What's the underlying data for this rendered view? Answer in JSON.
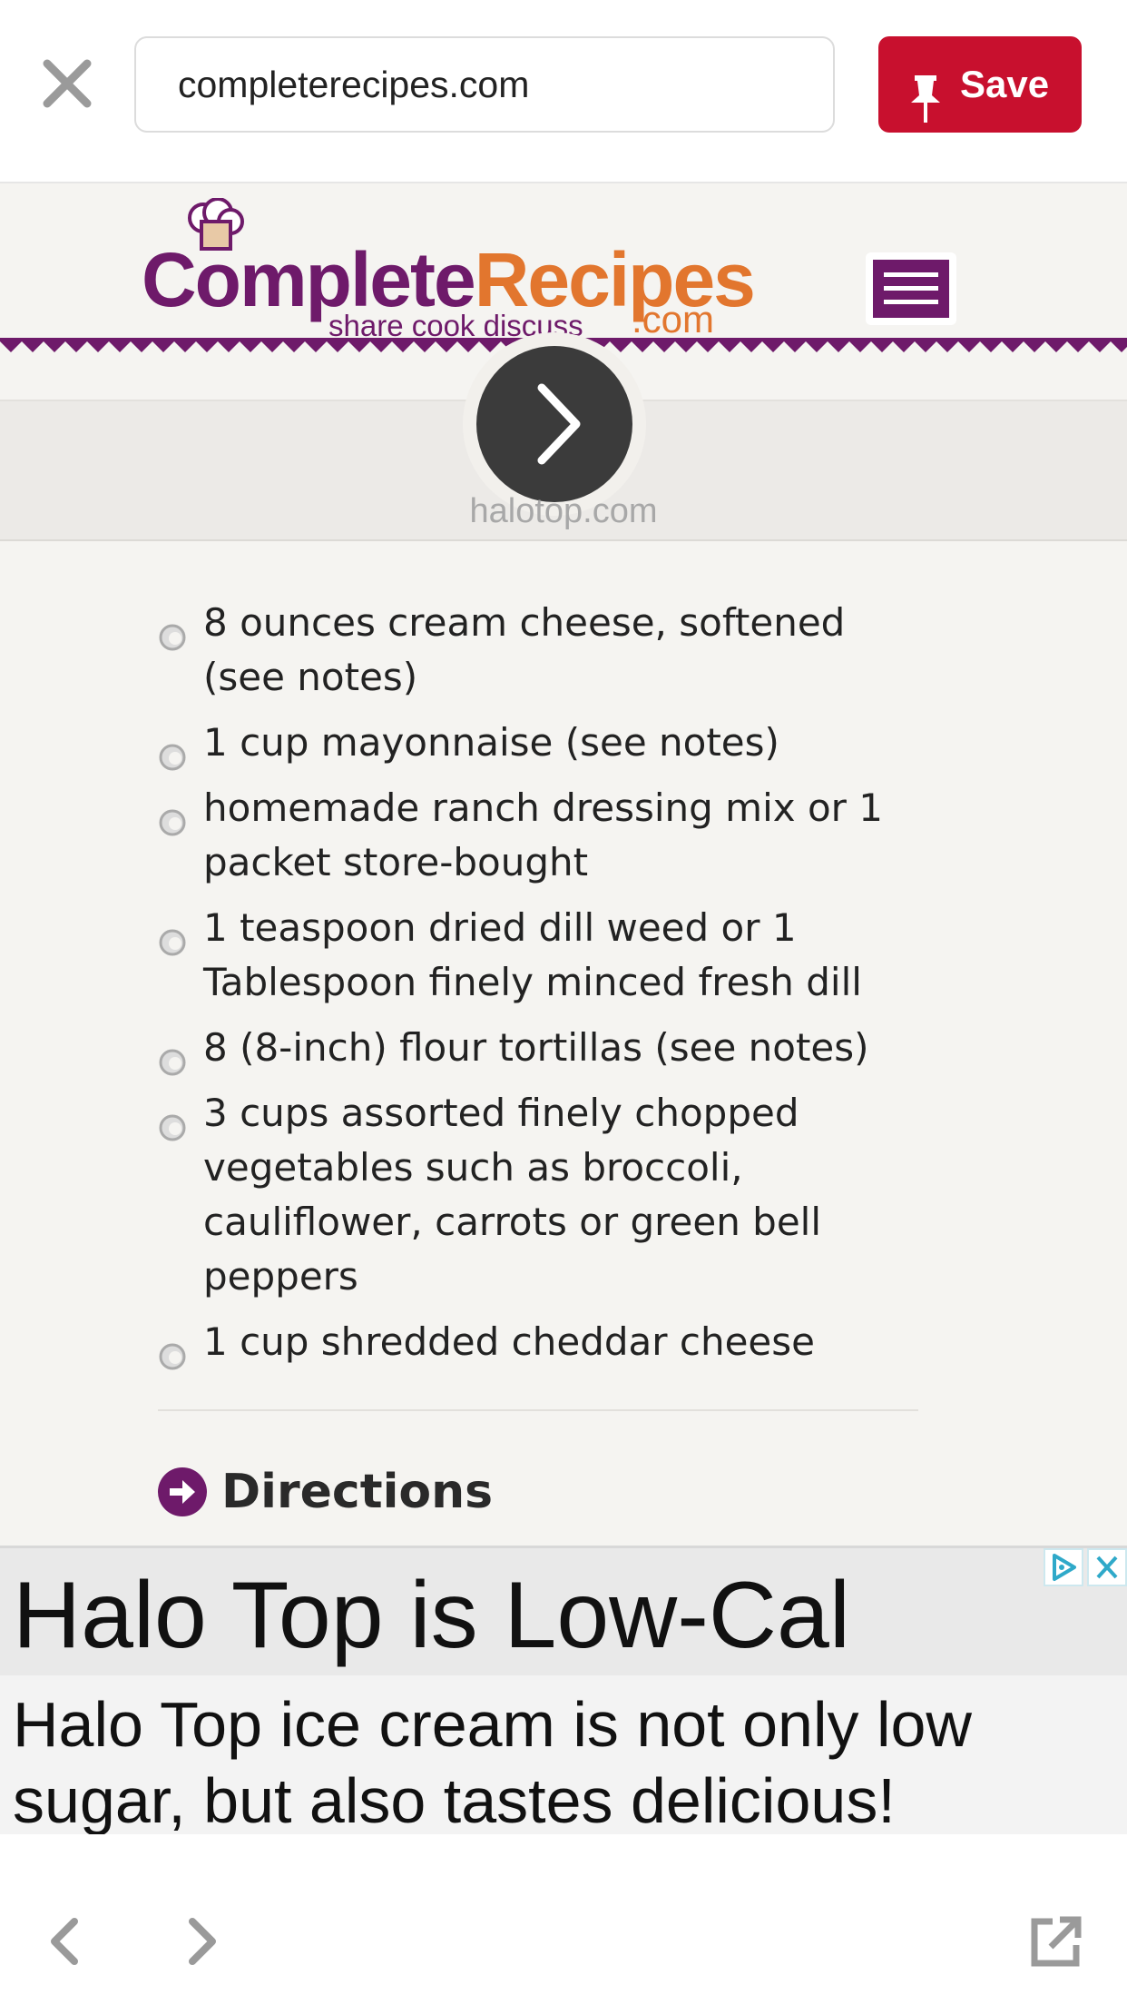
{
  "browser": {
    "close_icon": "close-icon",
    "url": "completerecipes.com",
    "save_label": "Save",
    "save_color": "#c8102e"
  },
  "site": {
    "logo_part1": "Complete",
    "logo_part2": "Recipes",
    "logo_tagline": "share cook discuss",
    "logo_suffix": ".com",
    "brand_color": "#6e1a6a",
    "accent_color": "#e2762e",
    "menu_icon": "hamburger-menu-icon"
  },
  "carousel": {
    "source": "halotop.com",
    "next_icon": "chevron-right-icon"
  },
  "ingredients": [
    "8 ounces cream cheese, softened (see notes)",
    "1 cup mayonnaise (see notes)",
    "homemade ranch dressing mix or 1 packet store-bought",
    "1 teaspoon dried dill weed or 1 Tablespoon finely minced fresh dill",
    "8 (8-inch) flour tortillas (see notes)",
    "3 cups assorted finely chopped vegetables such as broccoli, cauliflower, carrots or green bell peppers",
    "1 cup shredded cheddar cheese"
  ],
  "directions": {
    "label": "Directions",
    "icon": "arrow-circle-right-icon"
  },
  "ad": {
    "headline": "Halo Top is Low-Cal",
    "body": "Halo Top ice cream is not only low sugar, but also tastes delicious!",
    "adchoices_icon": "adchoices-icon",
    "close_icon": "ad-close-icon"
  },
  "toolbar": {
    "back_icon": "back-arrow-icon",
    "forward_icon": "forward-arrow-icon",
    "share_icon": "open-external-icon"
  }
}
